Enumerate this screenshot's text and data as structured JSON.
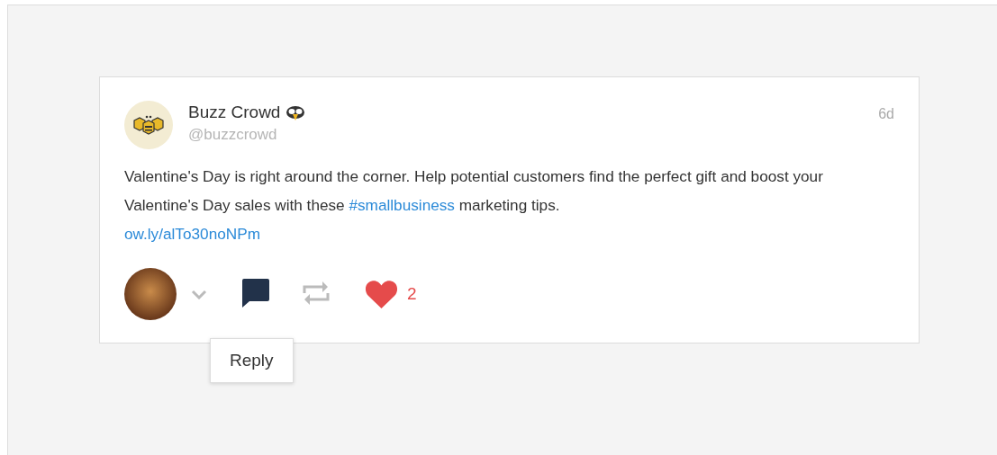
{
  "post": {
    "author": "Buzz Crowd",
    "handle": "@buzzcrowd",
    "time": "6d",
    "body": [
      {
        "kind": "text",
        "text": "Valentine's Day is right around the corner. Help potential customers find the perfect gift and boost your Valentine's Day sales with these "
      },
      {
        "kind": "hashtag",
        "text": "#smallbusiness"
      },
      {
        "kind": "text",
        "text": " marketing tips."
      },
      {
        "kind": "link",
        "text": "ow.ly/alTo30noNPm"
      }
    ],
    "actions": {
      "liked": true,
      "like_count": "2",
      "reply_active": true
    },
    "tooltip": "Reply"
  }
}
